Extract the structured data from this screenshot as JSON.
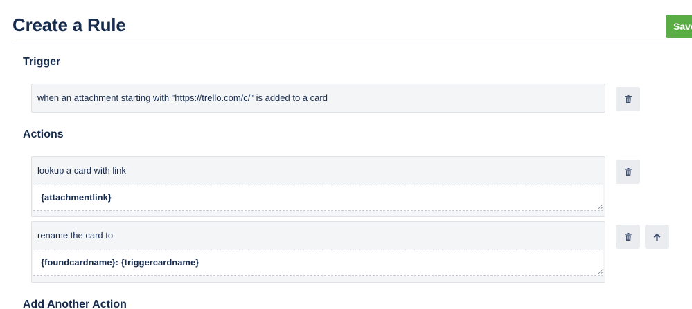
{
  "header": {
    "title": "Create a Rule",
    "save_label": "Save"
  },
  "trigger": {
    "section_title": "Trigger",
    "text": "when an attachment starting with \"https://trello.com/c/\" is added to a card",
    "delete_icon": "trash-icon"
  },
  "actions": {
    "section_title": "Actions",
    "items": [
      {
        "text": "lookup a card with link",
        "param_value": "{attachmentlink}",
        "icons": [
          "trash-icon"
        ]
      },
      {
        "text": "rename the card to",
        "param_value": "{foundcardname}: {triggercardname}",
        "icons": [
          "trash-icon",
          "arrow-up-icon"
        ]
      }
    ]
  },
  "add_action": {
    "section_title": "Add Another Action"
  },
  "colors": {
    "save_button": "#5aac44",
    "text": "#172b4d",
    "box_background": "#f4f5f7",
    "icon_button_background": "#ebecf0"
  }
}
